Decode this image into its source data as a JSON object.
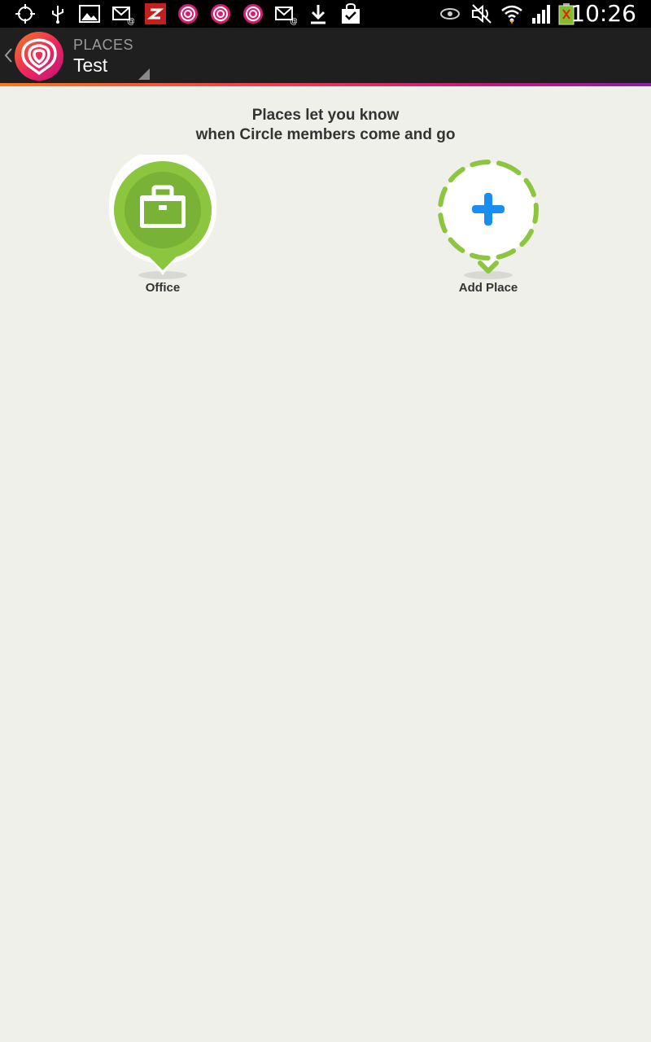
{
  "status_bar": {
    "icons_left": [
      "gps-icon",
      "usb-icon",
      "gallery-icon",
      "email-icon",
      "app-z-icon",
      "life360-icon",
      "life360-icon",
      "life360-icon",
      "email-icon",
      "download-icon",
      "shopping-bag-icon"
    ],
    "icons_right": [
      "eye-icon",
      "mute-icon",
      "wifi-icon",
      "signal-icon",
      "battery-charging-icon"
    ],
    "time": "10:26"
  },
  "action_bar": {
    "section": "PLACES",
    "circle_name": "Test",
    "logo_icon": "life360-logo-icon",
    "accent_gradient": [
      "#f47a20",
      "#ef3a54",
      "#c21a7c",
      "#8a1fa8"
    ]
  },
  "main": {
    "heading_line1": "Places let you know",
    "heading_line2": "when Circle members come and go",
    "places": [
      {
        "label": "Office",
        "icon": "briefcase-icon",
        "color": "#8cc63f"
      },
      {
        "label": "Add Place",
        "icon": "plus-icon",
        "color": "#1a8ef0"
      }
    ]
  }
}
